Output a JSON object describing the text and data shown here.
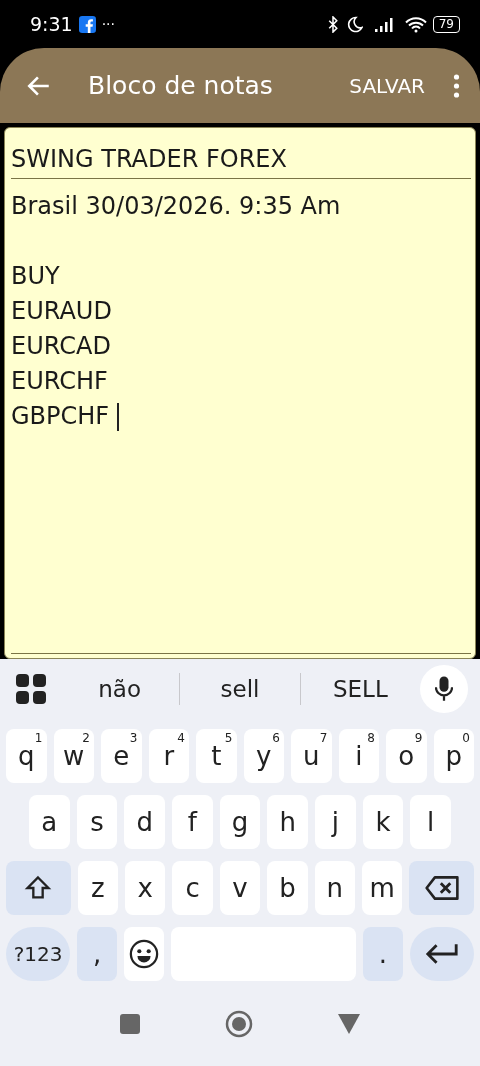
{
  "status_bar": {
    "time": "9:31",
    "more": "···",
    "battery": "79"
  },
  "app_bar": {
    "title": "Bloco de notas",
    "save": "SALVAR"
  },
  "note": {
    "title": "SWING TRADER FOREX",
    "date": "Brasil 30/03/2026. 9:35  Am",
    "lines": [
      {
        "text": "BUY",
        "caret": false
      },
      {
        "text": "EURAUD",
        "caret": false
      },
      {
        "text": "EURCAD",
        "caret": false
      },
      {
        "text": "EURCHF",
        "caret": false
      },
      {
        "text": "GBPCHF",
        "caret": true
      }
    ]
  },
  "keyboard": {
    "suggestions": [
      "não",
      "sell",
      "SELL"
    ],
    "rows": [
      {
        "keys": [
          {
            "kind": "letter",
            "label": "q",
            "hint": "1"
          },
          {
            "kind": "letter",
            "label": "w",
            "hint": "2"
          },
          {
            "kind": "letter",
            "label": "e",
            "hint": "3"
          },
          {
            "kind": "letter",
            "label": "r",
            "hint": "4"
          },
          {
            "kind": "letter",
            "label": "t",
            "hint": "5"
          },
          {
            "kind": "letter",
            "label": "y",
            "hint": "6"
          },
          {
            "kind": "letter",
            "label": "u",
            "hint": "7"
          },
          {
            "kind": "letter",
            "label": "i",
            "hint": "8"
          },
          {
            "kind": "letter",
            "label": "o",
            "hint": "9"
          },
          {
            "kind": "letter",
            "label": "p",
            "hint": "0"
          }
        ]
      },
      {
        "keys": [
          {
            "kind": "letter",
            "label": "a"
          },
          {
            "kind": "letter",
            "label": "s"
          },
          {
            "kind": "letter",
            "label": "d"
          },
          {
            "kind": "letter",
            "label": "f"
          },
          {
            "kind": "letter",
            "label": "g"
          },
          {
            "kind": "letter",
            "label": "h"
          },
          {
            "kind": "letter",
            "label": "j"
          },
          {
            "kind": "letter",
            "label": "k"
          },
          {
            "kind": "letter",
            "label": "l"
          }
        ]
      },
      {
        "keys": [
          {
            "kind": "shift"
          },
          {
            "kind": "letter",
            "label": "z"
          },
          {
            "kind": "letter",
            "label": "x"
          },
          {
            "kind": "letter",
            "label": "c"
          },
          {
            "kind": "letter",
            "label": "v"
          },
          {
            "kind": "letter",
            "label": "b"
          },
          {
            "kind": "letter",
            "label": "n"
          },
          {
            "kind": "letter",
            "label": "m"
          },
          {
            "kind": "backspace"
          }
        ]
      },
      {
        "keys": [
          {
            "kind": "symbols",
            "label": "?123"
          },
          {
            "kind": "punct",
            "label": ","
          },
          {
            "kind": "emoji"
          },
          {
            "kind": "space"
          },
          {
            "kind": "punct",
            "label": "."
          },
          {
            "kind": "enter"
          }
        ]
      }
    ]
  }
}
